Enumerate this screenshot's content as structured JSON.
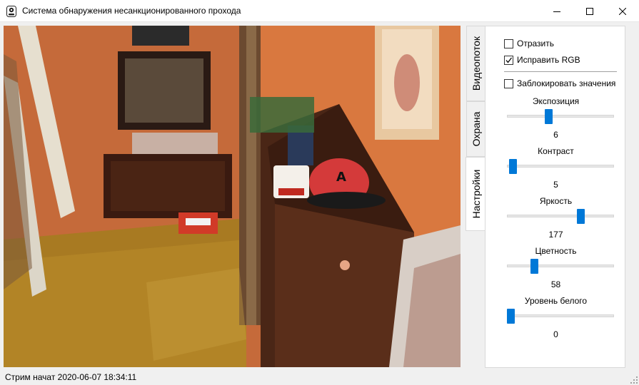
{
  "window": {
    "title": "Система обнаружения несанкционированного прохода"
  },
  "tabs": [
    {
      "label": "Видеопоток"
    },
    {
      "label": "Охрана"
    },
    {
      "label": "Настройки"
    }
  ],
  "settings": {
    "mirror": {
      "label": "Отразить",
      "checked": false
    },
    "fix_rgb": {
      "label": "Исправить RGB",
      "checked": true
    },
    "lock_values": {
      "label": "Заблокировать значения",
      "checked": false
    },
    "sliders": [
      {
        "label": "Экспозиция",
        "value": "6",
        "position": 0.39
      },
      {
        "label": "Контраст",
        "value": "5",
        "position": 0.05
      },
      {
        "label": "Яркость",
        "value": "177",
        "position": 0.69
      },
      {
        "label": "Цветность",
        "value": "58",
        "position": 0.25
      },
      {
        "label": "Уровень белого",
        "value": "0",
        "position": 0.03
      }
    ]
  },
  "status": {
    "text": "Стрим начат 2020-06-07 18:34:11"
  },
  "colors": {
    "accent": "#0078d7",
    "wall": "#c86a36"
  }
}
